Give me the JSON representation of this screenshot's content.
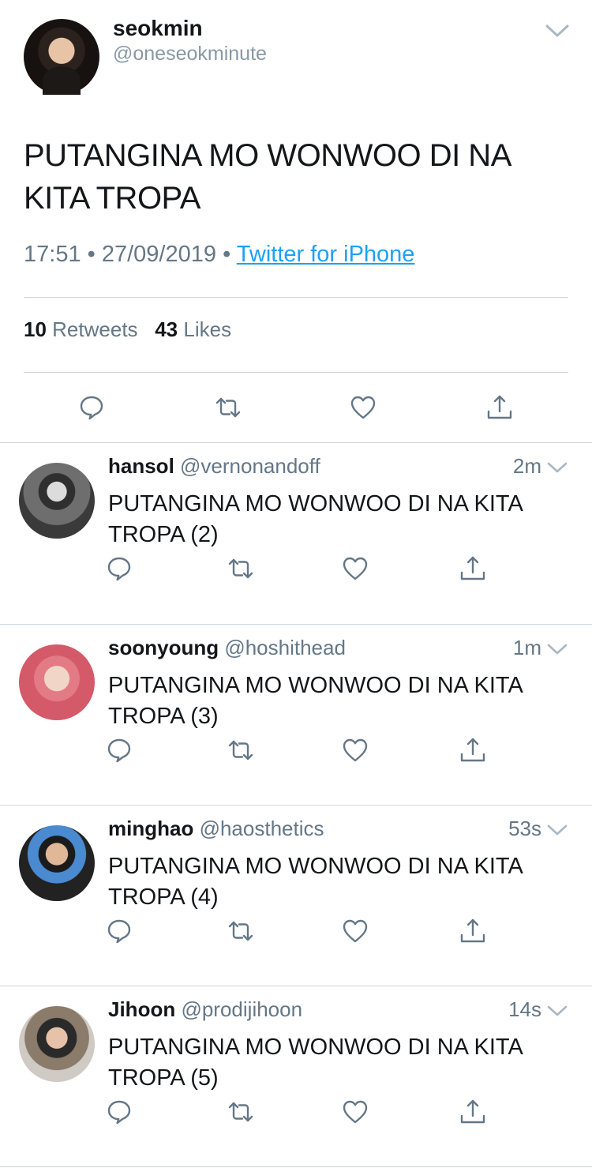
{
  "main_tweet": {
    "name": "seokmin",
    "handle": "@oneseokminute",
    "text": "PUTANGINA MO WONWOO DI NA KITA TROPA",
    "time": "17:51",
    "date": "27/09/2019",
    "separator": "•",
    "source": "Twitter for iPhone",
    "retweets_count": "10",
    "retweets_label": "Retweets",
    "likes_count": "43",
    "likes_label": "Likes"
  },
  "replies": [
    {
      "name": "hansol",
      "handle": "@vernonandoff",
      "time": "2m",
      "text": "PUTANGINA MO WONWOO DI NA KITA TROPA (2)"
    },
    {
      "name": "soonyoung",
      "handle": "@hoshithead",
      "time": "1m",
      "text": "PUTANGINA MO WONWOO DI NA KITA TROPA (3)"
    },
    {
      "name": "minghao",
      "handle": "@haosthetics",
      "time": "53s",
      "text": "PUTANGINA MO WONWOO DI NA KITA TROPA (4)"
    },
    {
      "name": "Jihoon",
      "handle": "@prodijihoon",
      "time": "14s",
      "text": "PUTANGINA MO WONWOO DI NA KITA TROPA (5)"
    }
  ],
  "icons": {
    "reply": "reply-icon",
    "retweet": "retweet-icon",
    "like": "heart-icon",
    "share": "share-icon",
    "menu": "chevron-down-icon"
  },
  "colors": {
    "link": "#1da1f2",
    "secondary_text": "#657786",
    "icon": "#657786",
    "divider": "#ccd6dd"
  }
}
